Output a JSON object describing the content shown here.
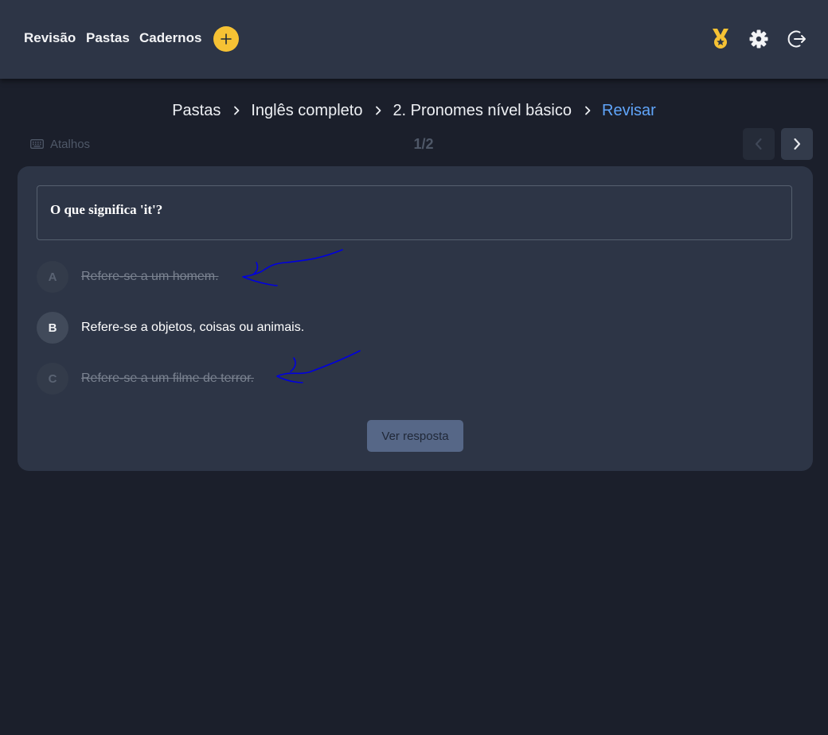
{
  "nav": {
    "links": [
      "Revisão",
      "Pastas",
      "Cadernos"
    ],
    "add_label": "+",
    "icons": [
      "medal-icon",
      "settings-icon",
      "logout-icon"
    ],
    "brand_accent": "#f6c234"
  },
  "breadcrumb": {
    "items": [
      "Pastas",
      "Inglês completo",
      "2. Pronomes nível básico"
    ],
    "current": "Revisar"
  },
  "toolbar": {
    "shortcuts_label": "Atalhos",
    "counter": "1/2"
  },
  "question": {
    "text": "O que significa 'it'?",
    "options": [
      {
        "letter": "A",
        "text": "Refere-se a um homem.",
        "state": "eliminated"
      },
      {
        "letter": "B",
        "text": "Refere-se a objetos, coisas ou animais.",
        "state": "active"
      },
      {
        "letter": "C",
        "text": "Refere-se a um filme de terror.",
        "state": "eliminated"
      }
    ],
    "reveal_label": "Ver resposta"
  },
  "colors": {
    "background": "#1b1f2b",
    "surface": "#2d3546",
    "link_active": "#60a5fa",
    "annotation": "#0000e0"
  }
}
